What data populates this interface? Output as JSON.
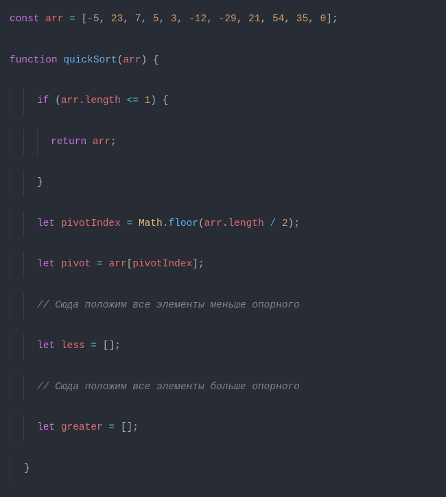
{
  "code": {
    "l1": {
      "kw": "const",
      "var": "arr",
      "eq": "=",
      "vals": [
        "-5",
        "23",
        "7",
        "5",
        "3",
        "-12",
        "-29",
        "21",
        "54",
        "35",
        "0"
      ],
      "open": "[",
      "close": "]",
      "semi": ";",
      "comma": ","
    },
    "l3": {
      "kw": "function",
      "fn": "quickSort",
      "op": "(",
      "arg": "arr",
      "cp": ")",
      "ob": "{"
    },
    "l5": {
      "kw": "if",
      "op": "(",
      "var": "arr",
      "dot": ".",
      "prop": "length",
      "cmp": "<=",
      "num": "1",
      "cp": ")",
      "ob": "{"
    },
    "l7": {
      "kw": "return",
      "var": "arr",
      "semi": ";"
    },
    "l9": {
      "cb": "}"
    },
    "l11": {
      "kw": "let",
      "var": "pivotIndex",
      "eq": "=",
      "obj": "Math",
      "dot": ".",
      "fn": "floor",
      "op": "(",
      "arg": "arr",
      "dot2": ".",
      "prop": "length",
      "div": "/",
      "num": "2",
      "cp": ")",
      "semi": ";"
    },
    "l13": {
      "kw": "let",
      "var": "pivot",
      "eq": "=",
      "arr": "arr",
      "ob": "[",
      "idx": "pivotIndex",
      "cb": "]",
      "semi": ";"
    },
    "l15": {
      "cmt": "// Сюда положим все элементы меньше опорного"
    },
    "l17": {
      "kw": "let",
      "var": "less",
      "eq": "=",
      "ob": "[",
      "cb": "]",
      "semi": ";"
    },
    "l19": {
      "cmt": "// Сюда положим все элементы больше опорного"
    },
    "l21": {
      "kw": "let",
      "var": "greater",
      "eq": "=",
      "ob": "[",
      "cb": "]",
      "semi": ";"
    },
    "l23": {
      "cb": "}"
    }
  }
}
